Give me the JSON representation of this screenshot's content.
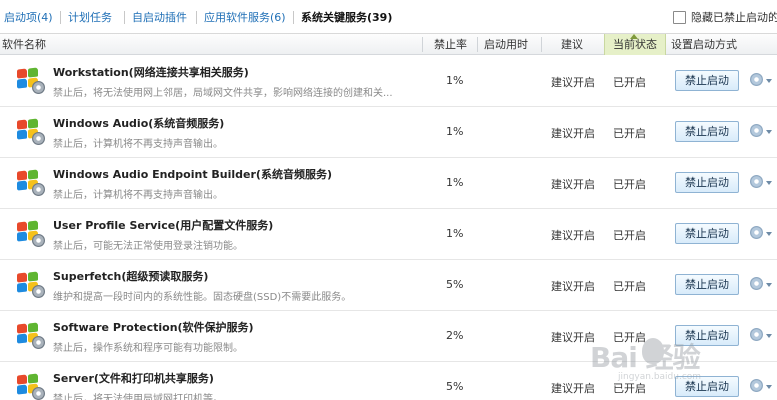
{
  "tabs": [
    {
      "label": "启动项(4)",
      "active": false
    },
    {
      "label": "计划任务",
      "active": false
    },
    {
      "label": "自启动插件",
      "active": false
    },
    {
      "label": "应用软件服务(6)",
      "active": false
    },
    {
      "label": "系统关键服务(39)",
      "active": true
    }
  ],
  "hide_disabled_label": "隐藏已禁止启动的",
  "columns": {
    "name": "软件名称",
    "disable_rate": "禁止率",
    "boot_time": "启动用时",
    "suggestion": "建议",
    "current_state": "当前状态",
    "setting": "设置启动方式"
  },
  "services": [
    {
      "name": "Workstation(网络连接共享相关服务)",
      "desc": "禁止后，将无法使用网上邻居，局域网文件共享，影响网络连接的创建和关...",
      "rate": "1%",
      "suggestion": "建议开启",
      "state": "已开启",
      "action": "禁止启动"
    },
    {
      "name": "Windows Audio(系统音频服务)",
      "desc": "禁止后，计算机将不再支持声音输出。",
      "rate": "1%",
      "suggestion": "建议开启",
      "state": "已开启",
      "action": "禁止启动"
    },
    {
      "name": "Windows Audio Endpoint Builder(系统音频服务)",
      "desc": "禁止后，计算机将不再支持声音输出。",
      "rate": "1%",
      "suggestion": "建议开启",
      "state": "已开启",
      "action": "禁止启动"
    },
    {
      "name": "User Profile Service(用户配置文件服务)",
      "desc": "禁止后，可能无法正常使用登录注销功能。",
      "rate": "1%",
      "suggestion": "建议开启",
      "state": "已开启",
      "action": "禁止启动"
    },
    {
      "name": "Superfetch(超级预读取服务)",
      "desc": "维护和提高一段时间内的系统性能。固态硬盘(SSD)不需要此服务。",
      "rate": "5%",
      "suggestion": "建议开启",
      "state": "已开启",
      "action": "禁止启动"
    },
    {
      "name": "Software Protection(软件保护服务)",
      "desc": "禁止后，操作系统和程序可能有功能限制。",
      "rate": "2%",
      "suggestion": "建议开启",
      "state": "已开启",
      "action": "禁止启动"
    },
    {
      "name": "Server(文件和打印机共享服务)",
      "desc": "禁止后，将无法使用局域网打印机等。",
      "rate": "5%",
      "suggestion": "建议开启",
      "state": "已开启",
      "action": "禁止启动"
    }
  ],
  "watermark": {
    "text": "Bai  经验",
    "sub": "jingyan.baidu.com"
  },
  "colors": {
    "tab_link": "#1f6fb6",
    "button_bg": "#d8ebfa",
    "sorted_header": "#e6f0c8"
  },
  "icons": {
    "service_icon": "windows-logo-gear-icon",
    "row_menu": "gear-dropdown-icon"
  }
}
